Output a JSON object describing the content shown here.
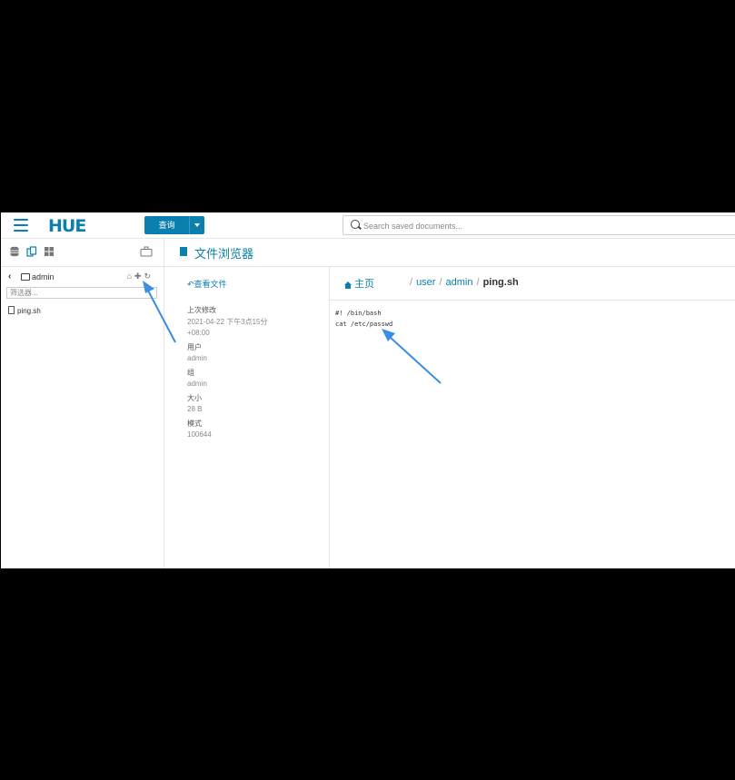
{
  "topbar": {
    "logo": "HUE",
    "query_button": "查询",
    "search_placeholder": "Search saved documents..."
  },
  "left_panel": {
    "icons": [
      "database-icon",
      "documents-icon",
      "grid-icon",
      "briefcase-icon"
    ],
    "folder_name": "admin",
    "tools": [
      "home-icon",
      "plus-icon",
      "refresh-icon"
    ],
    "filter_placeholder": "筛选器...",
    "files": [
      "ping.sh"
    ]
  },
  "file_browser": {
    "title": "文件浏览器",
    "view_link": "查看文件",
    "meta": [
      {
        "label": "上次修改",
        "value": "2021-04-22 下午3点15分 +08:00"
      },
      {
        "label": "用户",
        "value": "admin"
      },
      {
        "label": "组",
        "value": "admin"
      },
      {
        "label": "大小",
        "value": "28 B"
      },
      {
        "label": "模式",
        "value": "100644"
      }
    ],
    "breadcrumb": {
      "home": "主页",
      "segments": [
        "user",
        "admin"
      ],
      "current": "ping.sh"
    },
    "content_lines": [
      "#! /bin/bash",
      "cat /etc/passwd"
    ]
  },
  "colors": {
    "accent": "#0b7fad",
    "annotation_arrow": "#3a8ee6"
  }
}
